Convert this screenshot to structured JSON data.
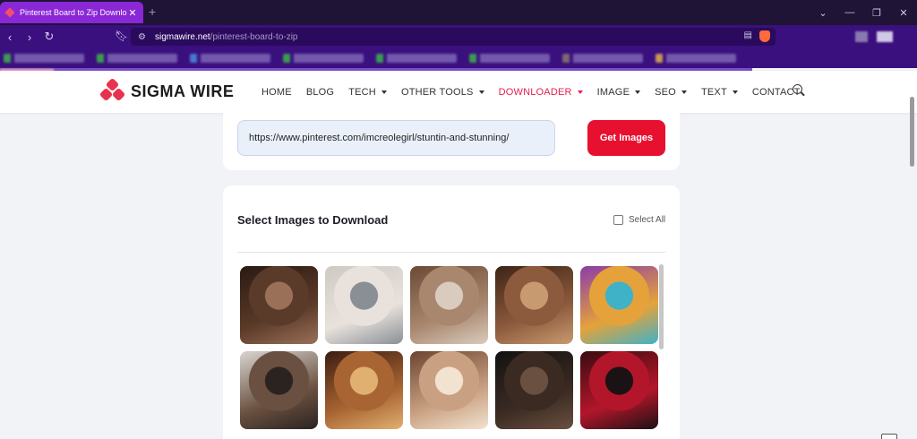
{
  "browser": {
    "tab_title": "Pinterest Board to Zip Download",
    "tab_close": "✕",
    "new_tab": "+",
    "url_host": "sigmawire.net",
    "url_path": "/pinterest-board-to-zip"
  },
  "site": {
    "logo_text": "SIGMA WIRE",
    "brand_color": "#e8334e",
    "nav": [
      {
        "label": "HOME",
        "dropdown": false
      },
      {
        "label": "BLOG",
        "dropdown": false
      },
      {
        "label": "TECH",
        "dropdown": true
      },
      {
        "label": "OTHER TOOLS",
        "dropdown": true
      },
      {
        "label": "DOWNLOADER",
        "dropdown": true,
        "active": true
      },
      {
        "label": "IMAGE",
        "dropdown": true
      },
      {
        "label": "SEO",
        "dropdown": true
      },
      {
        "label": "TEXT",
        "dropdown": true
      },
      {
        "label": "CONTACT",
        "dropdown": false
      }
    ]
  },
  "form": {
    "url_value": "https://www.pinterest.com/imcreolegirl/stuntin-and-stunning/",
    "submit_label": "Get Images"
  },
  "gallery": {
    "title": "Select Images to Download",
    "select_all_label": "Select All",
    "images": [
      {
        "name": "thumbnail-1",
        "colors": [
          "#2a1a12",
          "#5a3a28",
          "#9a7058"
        ]
      },
      {
        "name": "thumbnail-2",
        "colors": [
          "#cfc9c4",
          "#e9e2dc",
          "#8a8f96"
        ]
      },
      {
        "name": "thumbnail-3",
        "colors": [
          "#6b4a36",
          "#a8876e",
          "#d9cbbd"
        ]
      },
      {
        "name": "thumbnail-4",
        "colors": [
          "#3d2416",
          "#8c5a3c",
          "#c79a70"
        ]
      },
      {
        "name": "thumbnail-5",
        "colors": [
          "#8a3ca8",
          "#e5a23a",
          "#3fb2c8"
        ]
      },
      {
        "name": "thumbnail-6",
        "colors": [
          "#d9d5d2",
          "#6a5040",
          "#2b2320"
        ]
      },
      {
        "name": "thumbnail-7",
        "colors": [
          "#3b1d12",
          "#a86432",
          "#e0b070"
        ]
      },
      {
        "name": "thumbnail-8",
        "colors": [
          "#6b4530",
          "#c9a182",
          "#f2e3d0"
        ]
      },
      {
        "name": "thumbnail-9",
        "colors": [
          "#121212",
          "#3a2a22",
          "#6a5040"
        ]
      },
      {
        "name": "thumbnail-10",
        "colors": [
          "#3a0c10",
          "#b3162a",
          "#1a1214"
        ]
      }
    ]
  }
}
